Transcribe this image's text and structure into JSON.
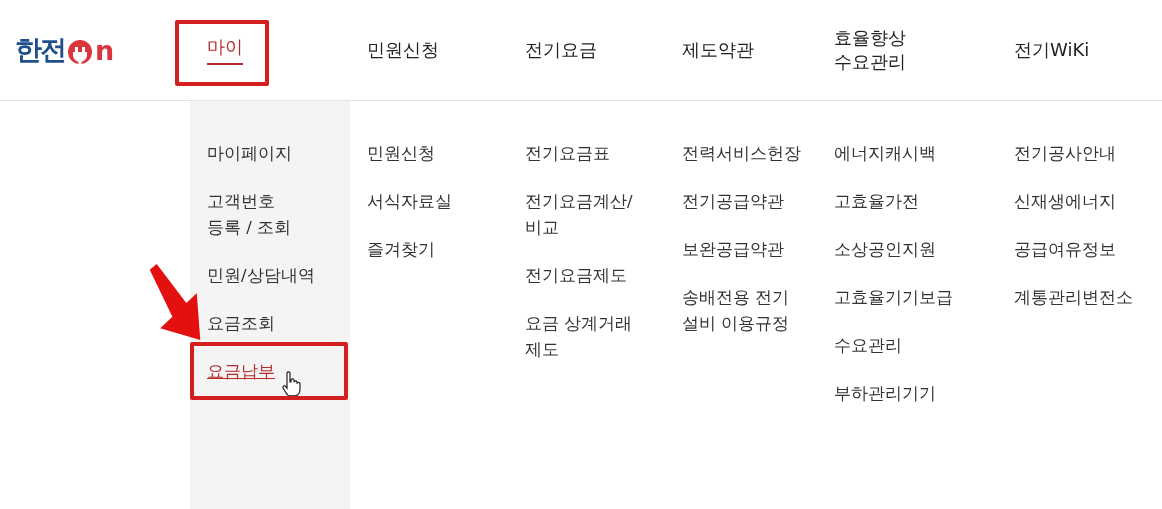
{
  "logo": {
    "text": "한전",
    "suffix": "n"
  },
  "nav": [
    {
      "label": "마이",
      "selected": true,
      "highlighted": true
    },
    {
      "label": "민원신청",
      "selected": false,
      "highlighted": false
    },
    {
      "label": "전기요금",
      "selected": false,
      "highlighted": false
    },
    {
      "label": "제도약관",
      "selected": false,
      "highlighted": false
    },
    {
      "label": "효율향상\n수요관리",
      "selected": false,
      "highlighted": false
    },
    {
      "label": "전기WiKi",
      "selected": false,
      "highlighted": false
    }
  ],
  "menu": [
    [
      {
        "label": "마이페이지",
        "selected": false
      },
      {
        "label": "고객번호\n등록 / 조회",
        "selected": false
      },
      {
        "label": "민원/상담내역",
        "selected": false
      },
      {
        "label": "요금조회",
        "selected": false
      },
      {
        "label": "요금납부",
        "selected": true
      }
    ],
    [
      {
        "label": "민원신청",
        "selected": false
      },
      {
        "label": "서식자료실",
        "selected": false
      },
      {
        "label": "즐겨찾기",
        "selected": false
      }
    ],
    [
      {
        "label": "전기요금표",
        "selected": false
      },
      {
        "label": "전기요금계산/\n비교",
        "selected": false
      },
      {
        "label": "전기요금제도",
        "selected": false
      },
      {
        "label": "요금 상계거래\n제도",
        "selected": false
      }
    ],
    [
      {
        "label": "전력서비스헌장",
        "selected": false
      },
      {
        "label": "전기공급약관",
        "selected": false
      },
      {
        "label": "보완공급약관",
        "selected": false
      },
      {
        "label": "송배전용 전기\n설비 이용규정",
        "selected": false
      }
    ],
    [
      {
        "label": "에너지캐시백",
        "selected": false
      },
      {
        "label": "고효율가전",
        "selected": false
      },
      {
        "label": "소상공인지원",
        "selected": false
      },
      {
        "label": "고효율기기보급",
        "selected": false
      },
      {
        "label": "수요관리",
        "selected": false
      },
      {
        "label": "부하관리기기",
        "selected": false
      }
    ],
    [
      {
        "label": "전기공사안내",
        "selected": false
      },
      {
        "label": "신재생에너지",
        "selected": false
      },
      {
        "label": "공급여유정보",
        "selected": false
      },
      {
        "label": "계통관리변전소",
        "selected": false
      }
    ]
  ]
}
